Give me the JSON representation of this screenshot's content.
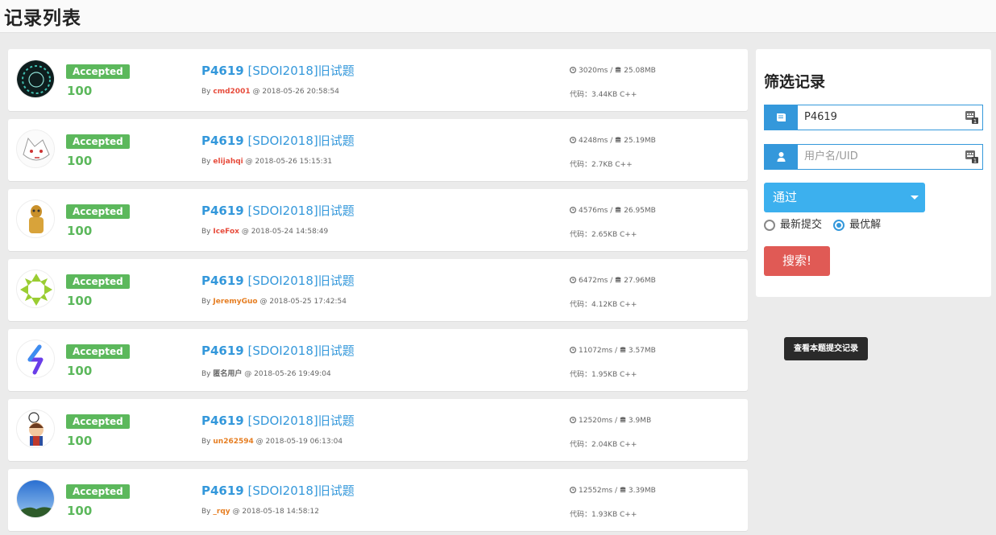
{
  "header": {
    "title": "记录列表"
  },
  "records": [
    {
      "status": "Accepted",
      "score": "100",
      "pid": "P4619",
      "title": "[SDOI2018]旧试题",
      "by": "By",
      "user": "cmd2001",
      "user_color": "#e74c3c",
      "at": "@ 2018-05-26 20:58:54",
      "time": "3020ms",
      "mem": "25.08MB",
      "code_label": "代码：",
      "code": "3.44KB C++",
      "avatar_icon": "dark-circle-avatar"
    },
    {
      "status": "Accepted",
      "score": "100",
      "pid": "P4619",
      "title": "[SDOI2018]旧试题",
      "by": "By",
      "user": "elijahqi",
      "user_color": "#e74c3c",
      "at": "@ 2018-05-26 15:15:31",
      "time": "4248ms",
      "mem": "25.19MB",
      "code_label": "代码：",
      "code": "2.7KB C++",
      "avatar_icon": "white-cat-avatar"
    },
    {
      "status": "Accepted",
      "score": "100",
      "pid": "P4619",
      "title": "[SDOI2018]旧试题",
      "by": "By",
      "user": "IceFox",
      "user_color": "#e74c3c",
      "at": "@ 2018-05-24 14:58:49",
      "time": "4576ms",
      "mem": "26.95MB",
      "code_label": "代码：",
      "code": "2.65KB C++",
      "avatar_icon": "golden-robot-avatar"
    },
    {
      "status": "Accepted",
      "score": "100",
      "pid": "P4619",
      "title": "[SDOI2018]旧试题",
      "by": "By",
      "user": "JeremyGuo",
      "user_color": "#e67e22",
      "at": "@ 2018-05-25 17:42:54",
      "time": "6472ms",
      "mem": "27.96MB",
      "code_label": "代码：",
      "code": "4.12KB C++",
      "avatar_icon": "green-triangles-avatar"
    },
    {
      "status": "Accepted",
      "score": "100",
      "pid": "P4619",
      "title": "[SDOI2018]旧试题",
      "by": "By",
      "user": "匿名用户",
      "user_color": "#666666",
      "at": "@ 2018-05-26 19:49:04",
      "time": "11072ms",
      "mem": "3.57MB",
      "code_label": "代码：",
      "code": "1.95KB C++",
      "avatar_icon": "purple-s-logo-avatar"
    },
    {
      "status": "Accepted",
      "score": "100",
      "pid": "P4619",
      "title": "[SDOI2018]旧试题",
      "by": "By",
      "user": "un262594",
      "user_color": "#e67e22",
      "at": "@ 2018-05-19 06:13:04",
      "time": "12520ms",
      "mem": "3.9MB",
      "code_label": "代码：",
      "code": "2.04KB C++",
      "avatar_icon": "cartoon-boy-avatar"
    },
    {
      "status": "Accepted",
      "score": "100",
      "pid": "P4619",
      "title": "[SDOI2018]旧试题",
      "by": "By",
      "user": "_rqy",
      "user_color": "#e67e22",
      "at": "@ 2018-05-18 14:58:12",
      "time": "12552ms",
      "mem": "3.39MB",
      "code_label": "代码：",
      "code": "1.93KB C++",
      "avatar_icon": "sky-photo-avatar"
    }
  ],
  "filter": {
    "title": "筛选记录",
    "problem_value": "P4619",
    "user_placeholder": "用户名/UID",
    "status_selected": "通过",
    "order_options": [
      "最新提交",
      "最优解"
    ],
    "order_selected": "最优解",
    "search_label": "搜索!"
  },
  "tooltip": {
    "text": "查看本题提交记录"
  },
  "colors": {
    "accent": "#3498db",
    "accepted": "#5cb85c",
    "danger": "#e05a55",
    "select": "#3cb0ee"
  }
}
